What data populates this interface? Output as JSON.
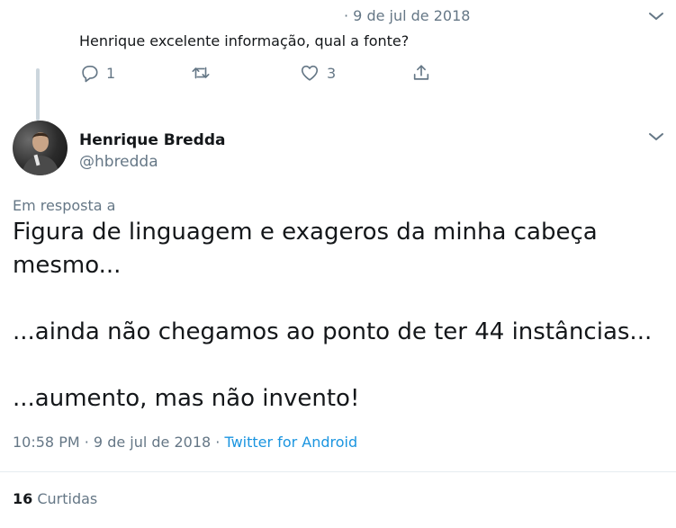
{
  "previous_tweet": {
    "date": "· 9 de jul de 2018",
    "text": "Henrique excelente informação, qual a fonte?",
    "actions": {
      "reply_count": "1",
      "retweet_count": "",
      "like_count": "3"
    }
  },
  "main_tweet": {
    "author_name": "Henrique Bredda",
    "author_handle": "@hbredda",
    "reply_to_label": "Em resposta a",
    "body_lines": [
      "Figura de linguagem e exageros da minha cabeça",
      "mesmo...",
      "",
      "...ainda não chegamos ao ponto de ter 44 instâncias...",
      "",
      "...aumento, mas não invento!"
    ],
    "time": "10:58 PM",
    "date": "9 de jul de 2018",
    "source": "Twitter for Android",
    "likes_count": "16",
    "likes_label": "Curtidas"
  },
  "icons": {
    "reply": "reply-icon",
    "retweet": "retweet-icon",
    "like": "heart-icon",
    "share": "share-icon",
    "more": "chevron-down-icon"
  },
  "colors": {
    "text": "#14171a",
    "muted": "#657786",
    "link": "#1b95e0",
    "divider": "#e6ecf0",
    "thread_line": "#ccd6dd"
  }
}
